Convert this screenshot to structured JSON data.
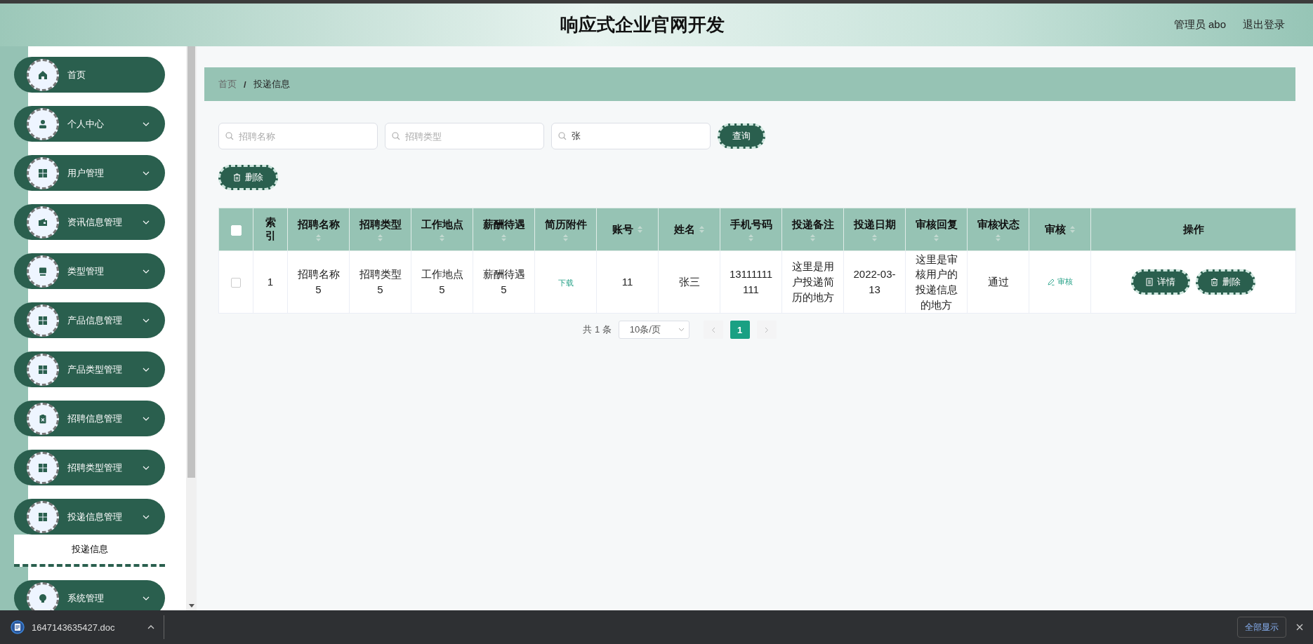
{
  "header": {
    "title": "响应式企业官网开发",
    "user": "管理员 abo",
    "logout": "退出登录"
  },
  "sidebar": {
    "items": [
      {
        "label": "首页",
        "kind": "home",
        "expandable": false
      },
      {
        "label": "个人中心",
        "kind": "user",
        "expandable": true
      },
      {
        "label": "用户管理",
        "kind": "grid",
        "expandable": true
      },
      {
        "label": "资讯信息管理",
        "kind": "wallet",
        "expandable": true
      },
      {
        "label": "类型管理",
        "kind": "monitor",
        "expandable": true
      },
      {
        "label": "产品信息管理",
        "kind": "grid",
        "expandable": true
      },
      {
        "label": "产品类型管理",
        "kind": "grid",
        "expandable": true
      },
      {
        "label": "招聘信息管理",
        "kind": "clipboard",
        "expandable": true
      },
      {
        "label": "招聘类型管理",
        "kind": "grid",
        "expandable": true
      },
      {
        "label": "投递信息管理",
        "kind": "grid",
        "expandable": true,
        "children": [
          {
            "label": "投递信息",
            "selected": true
          }
        ]
      },
      {
        "label": "系统管理",
        "kind": "bulb",
        "expandable": true
      }
    ]
  },
  "breadcrumb": {
    "items": [
      "首页",
      "投递信息"
    ],
    "separator": "/"
  },
  "search": {
    "fields": [
      {
        "placeholder": "招聘名称"
      },
      {
        "placeholder": "招聘类型"
      },
      {
        "value": "张"
      }
    ],
    "button": "查询"
  },
  "toolbar": {
    "delete": "删除"
  },
  "table": {
    "select_all": {
      "checked": false
    },
    "columns": [
      {
        "label": "索引",
        "sortable": false,
        "kind": "text"
      },
      {
        "label": "招聘名称",
        "sortable": true,
        "kind": "text"
      },
      {
        "label": "招聘类型",
        "sortable": true,
        "kind": "text"
      },
      {
        "label": "工作地点",
        "sortable": true,
        "kind": "text"
      },
      {
        "label": "薪酬待遇",
        "sortable": true,
        "kind": "text"
      },
      {
        "label": "简历附件",
        "sortable": true,
        "kind": "link"
      },
      {
        "label": "账号",
        "sortable": true,
        "kind": "text"
      },
      {
        "label": "姓名",
        "sortable": true,
        "kind": "text"
      },
      {
        "label": "手机号码",
        "sortable": true,
        "kind": "text"
      },
      {
        "label": "投递备注",
        "sortable": true,
        "kind": "text"
      },
      {
        "label": "投递日期",
        "sortable": true,
        "kind": "text"
      },
      {
        "label": "审核回复",
        "sortable": true,
        "kind": "text"
      },
      {
        "label": "审核状态",
        "sortable": true,
        "kind": "text"
      },
      {
        "label": "审核",
        "sortable": true,
        "kind": "review"
      },
      {
        "label": "操作",
        "sortable": false,
        "kind": "actions"
      }
    ],
    "rows": [
      {
        "checked": false,
        "cells": [
          "1",
          "招聘名称5",
          "招聘类型5",
          "工作地点5",
          "薪酬待遇5",
          "下载",
          "11",
          "张三",
          "13111111111",
          "这里是用户投递简历的地方",
          "2022-03-13",
          "这里是审核用户的投递信息的地方",
          "通过",
          "审核"
        ],
        "actions": [
          "详情",
          "删除"
        ]
      }
    ]
  },
  "pagination": {
    "total": "共 1 条",
    "page_size": "10条/页",
    "pages": [
      {
        "label": "1",
        "selected": true
      }
    ]
  },
  "download_bar": {
    "file": "1647143635427.doc",
    "show_all": "全部显示"
  }
}
